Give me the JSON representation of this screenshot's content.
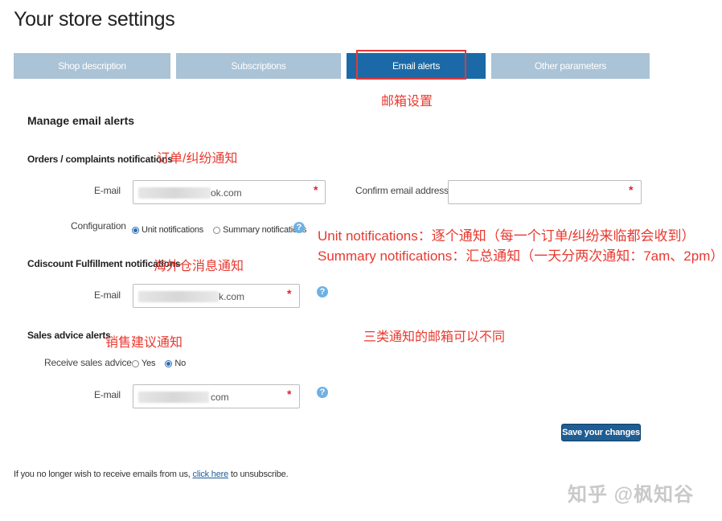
{
  "page": {
    "title": "Your store settings"
  },
  "tabs": [
    {
      "label": "Shop description",
      "active": false
    },
    {
      "label": "Subscriptions",
      "active": false
    },
    {
      "label": "Email alerts",
      "active": true
    },
    {
      "label": "Other parameters",
      "active": false
    }
  ],
  "annotations": {
    "email_settings": "邮箱设置",
    "orders_complaints": "订单/纠纷通知",
    "unit_notifications": "Unit notifications：逐个通知（每一个订单/纠纷来临都会收到）",
    "summary_notifications": "Summary notifications：汇总通知（一天分两次通知：7am、2pm）",
    "fulfillment": "海外仓消息通知",
    "sales_advice": "销售建议通知",
    "different_emails": "三类通知的邮箱可以不同"
  },
  "form": {
    "section_title": "Manage email alerts",
    "orders": {
      "heading": "Orders / complaints notifications",
      "email_label": "E-mail",
      "email_value": "ok.com",
      "confirm_label": "Confirm email address",
      "confirm_value": "",
      "config_label": "Configuration",
      "options": [
        "Unit notifications",
        "Summary notifications"
      ],
      "selected": "Unit notifications"
    },
    "fulfillment": {
      "heading": "Cdiscount Fulfillment notifications",
      "email_label": "E-mail",
      "email_value": "k.com"
    },
    "sales": {
      "heading": "Sales advice alerts",
      "receive_label": "Receive sales advice",
      "options": [
        "Yes",
        "No"
      ],
      "selected": "No",
      "email_label": "E-mail",
      "email_value": "com"
    },
    "required_mark": "*",
    "help_icon": "?",
    "save_label": "Save your changes"
  },
  "footer": {
    "before": "If you no longer wish to receive emails from us,",
    "link": "click here",
    "after": "to unsubscribe."
  },
  "watermark": "知乎 @枫知谷",
  "colors": {
    "tab_inactive": "#aac3d6",
    "tab_active": "#1b6aa7",
    "annotation_red": "#e8392f",
    "button": "#1f5d93"
  }
}
